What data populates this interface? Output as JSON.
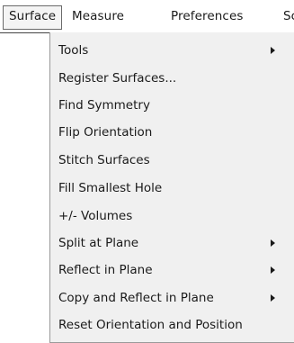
{
  "menubar": {
    "items": [
      {
        "label": "Surface"
      },
      {
        "label": "Measure"
      },
      {
        "label": "Preferences"
      },
      {
        "label": "Scu"
      }
    ]
  },
  "surface_menu": {
    "items": [
      {
        "label": "Tools",
        "has_submenu": true
      },
      {
        "label": "Register Surfaces...",
        "has_submenu": false
      },
      {
        "label": "Find Symmetry",
        "has_submenu": false
      },
      {
        "label": "Flip Orientation",
        "has_submenu": false
      },
      {
        "label": "Stitch Surfaces",
        "has_submenu": false
      },
      {
        "label": "Fill Smallest Hole",
        "has_submenu": false
      },
      {
        "label": "+/- Volumes",
        "has_submenu": false
      },
      {
        "label": "Split at Plane",
        "has_submenu": true
      },
      {
        "label": "Reflect in Plane",
        "has_submenu": true
      },
      {
        "label": "Copy and Reflect in Plane",
        "has_submenu": true
      },
      {
        "label": "Reset Orientation and Position",
        "has_submenu": false
      }
    ]
  },
  "icons": {
    "submenu_arrow": "chevron-right-icon"
  }
}
